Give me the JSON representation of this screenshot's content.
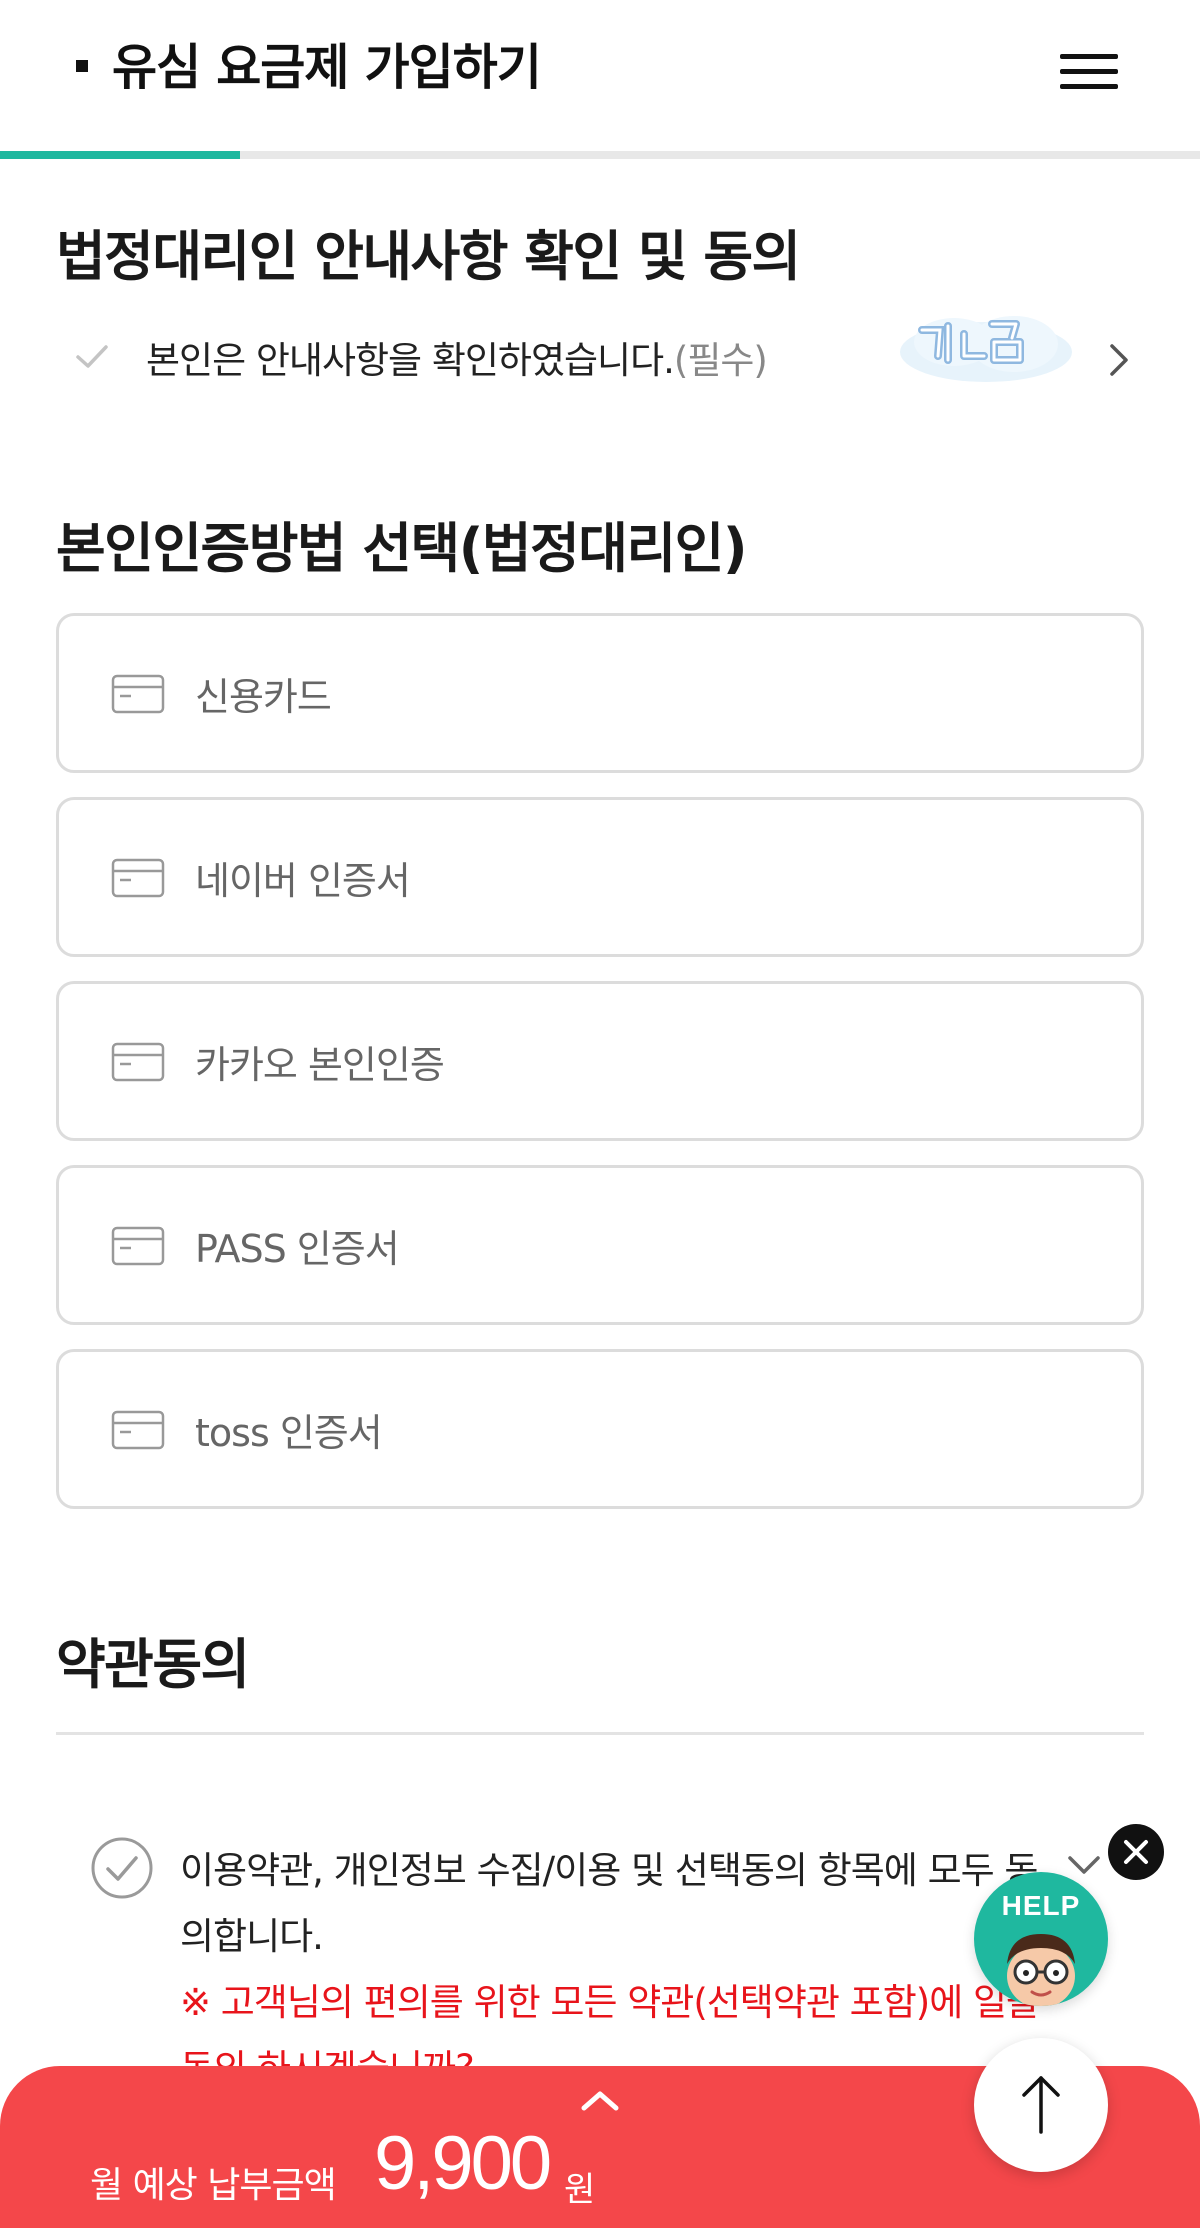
{
  "header": {
    "title": "유심 요금제 가입하기",
    "menu_icon": "hamburger-menu-icon",
    "progress_percent": 20,
    "accent_color": "#1fb89f"
  },
  "legal_rep": {
    "title": "법정대리인 안내사항 확인 및 동의",
    "check_text": "본인은 안내사항을 확인하였습니다.",
    "required_label": "(필수)",
    "checked": false
  },
  "auth_method": {
    "title": "본인인증방법 선택(법정대리인)",
    "options": [
      {
        "label": "신용카드",
        "icon": "card-icon"
      },
      {
        "label": "네이버 인증서",
        "icon": "card-icon"
      },
      {
        "label": "카카오 본인인증",
        "icon": "card-icon"
      },
      {
        "label": "PASS 인증서",
        "icon": "card-icon"
      },
      {
        "label": "toss 인증서",
        "icon": "card-icon"
      }
    ]
  },
  "terms": {
    "title": "약관동의",
    "agree_all_text": "이용약관, 개인정보 수집/이용 및 선택동의 항목에 모두 동의합니다.",
    "warning_text": "※ 고객님의 편의를 위한 모든 약관(선택약관 포함)에 일괄동의 하시겠습니까?",
    "warning_color": "#e8141b"
  },
  "floating": {
    "help_label": "HELP",
    "close_icon": "close-icon",
    "top_icon": "arrow-up-icon"
  },
  "bottom_bar": {
    "price_label": "월 예상 납부금액",
    "price_value": "9,900",
    "price_unit": "원",
    "color": "#f4474a"
  }
}
